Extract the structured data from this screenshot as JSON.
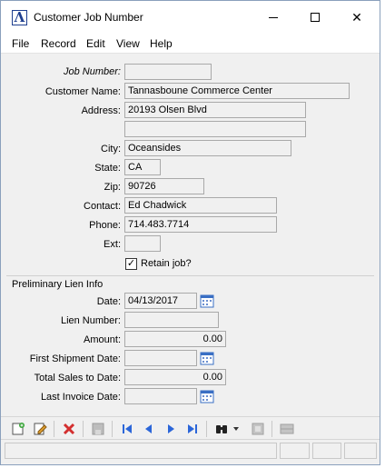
{
  "window": {
    "title": "Customer Job Number",
    "controls": {
      "minimize_icon": "minimize-icon",
      "maximize_icon": "maximize-icon",
      "close_glyph": "✕"
    }
  },
  "menu": [
    "File",
    "Record",
    "Edit",
    "View",
    "Help"
  ],
  "form": {
    "job_number_label": "Job Number:",
    "job_number_value": "",
    "customer_name_label": "Customer Name:",
    "customer_name_value": "Tannasboune Commerce Center",
    "address_label": "Address:",
    "address_line1": "20193 Olsen Blvd",
    "address_line2": "",
    "city_label": "City:",
    "city_value": "Oceansides",
    "state_label": "State:",
    "state_value": "CA",
    "zip_label": "Zip:",
    "zip_value": "90726",
    "contact_label": "Contact:",
    "contact_value": "Ed Chadwick",
    "phone_label": "Phone:",
    "phone_value": "714.483.7714",
    "ext_label": "Ext:",
    "ext_value": "",
    "retain_job_label": "Retain job?",
    "retain_job_checked": "✓"
  },
  "lien": {
    "section_title": "Preliminary Lien Info",
    "date_label": "Date:",
    "date_value": "04/13/2017",
    "lien_number_label": "Lien Number:",
    "lien_number_value": "",
    "amount_label": "Amount:",
    "amount_value": "0.00",
    "first_shipment_label": "First Shipment Date:",
    "first_shipment_value": "",
    "total_sales_label": "Total Sales to Date:",
    "total_sales_value": "0.00",
    "last_invoice_label": "Last Invoice Date:",
    "last_invoice_value": ""
  },
  "colors": {
    "accent_blue": "#2b66d9",
    "delete_red": "#d32f2f",
    "calendar_blue": "#3a6fc4"
  }
}
